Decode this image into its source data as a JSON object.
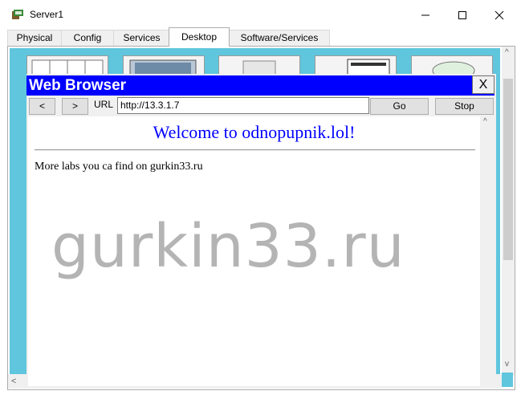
{
  "window": {
    "title": "Server1"
  },
  "tabs": [
    {
      "label": "Physical"
    },
    {
      "label": "Config"
    },
    {
      "label": "Services"
    },
    {
      "label": "Desktop",
      "active": true
    },
    {
      "label": "Software/Services"
    }
  ],
  "browser": {
    "title": "Web Browser",
    "close_label": "X",
    "back_label": "<",
    "forward_label": ">",
    "url_label": "URL",
    "url_value": "http://13.3.1.7",
    "go_label": "Go",
    "stop_label": "Stop",
    "page": {
      "heading": "Welcome to odnopupnik.lol!",
      "text": "More labs you ca find on gurkin33.ru"
    }
  },
  "watermark": "gurkin33.ru",
  "icons": [
    "server-app-icon",
    "minimize-icon",
    "maximize-icon",
    "close-icon"
  ]
}
